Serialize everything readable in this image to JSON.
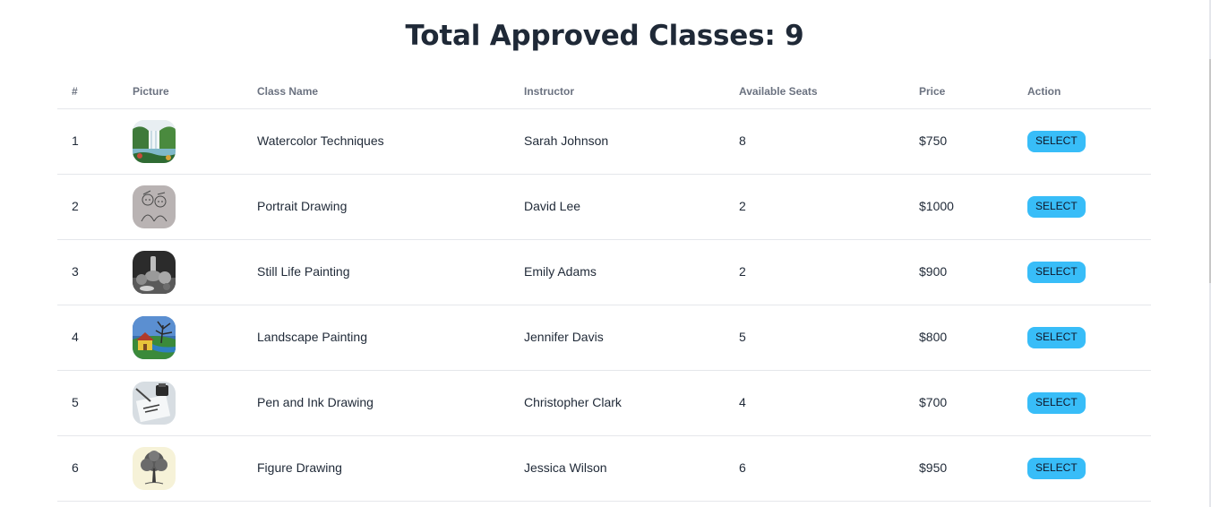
{
  "page": {
    "title": "Total Approved Classes: 9"
  },
  "table": {
    "headers": {
      "num": "#",
      "picture": "Picture",
      "class_name": "Class Name",
      "instructor": "Instructor",
      "seats": "Available Seats",
      "price": "Price",
      "action": "Action"
    },
    "rows": [
      {
        "num": "1",
        "class_name": "Watercolor Techniques",
        "instructor": "Sarah Johnson",
        "seats": "8",
        "price": "$750",
        "action": "SELECT",
        "picture": "waterfall-painting-image"
      },
      {
        "num": "2",
        "class_name": "Portrait Drawing",
        "instructor": "David Lee",
        "seats": "2",
        "price": "$1000",
        "action": "SELECT",
        "picture": "portrait-sketch-image"
      },
      {
        "num": "3",
        "class_name": "Still Life Painting",
        "instructor": "Emily Adams",
        "seats": "2",
        "price": "$900",
        "action": "SELECT",
        "picture": "still-life-image"
      },
      {
        "num": "4",
        "class_name": "Landscape Painting",
        "instructor": "Jennifer Davis",
        "seats": "5",
        "price": "$800",
        "action": "SELECT",
        "picture": "landscape-painting-image"
      },
      {
        "num": "5",
        "class_name": "Pen and Ink Drawing",
        "instructor": "Christopher Clark",
        "seats": "4",
        "price": "$700",
        "action": "SELECT",
        "picture": "pen-ink-image"
      },
      {
        "num": "6",
        "class_name": "Figure Drawing",
        "instructor": "Jessica Wilson",
        "seats": "6",
        "price": "$950",
        "action": "SELECT",
        "picture": "tree-sketch-image"
      }
    ]
  },
  "colors": {
    "button": "#38bdf8",
    "header_text": "#6b7280",
    "divider": "#e5e7eb"
  }
}
